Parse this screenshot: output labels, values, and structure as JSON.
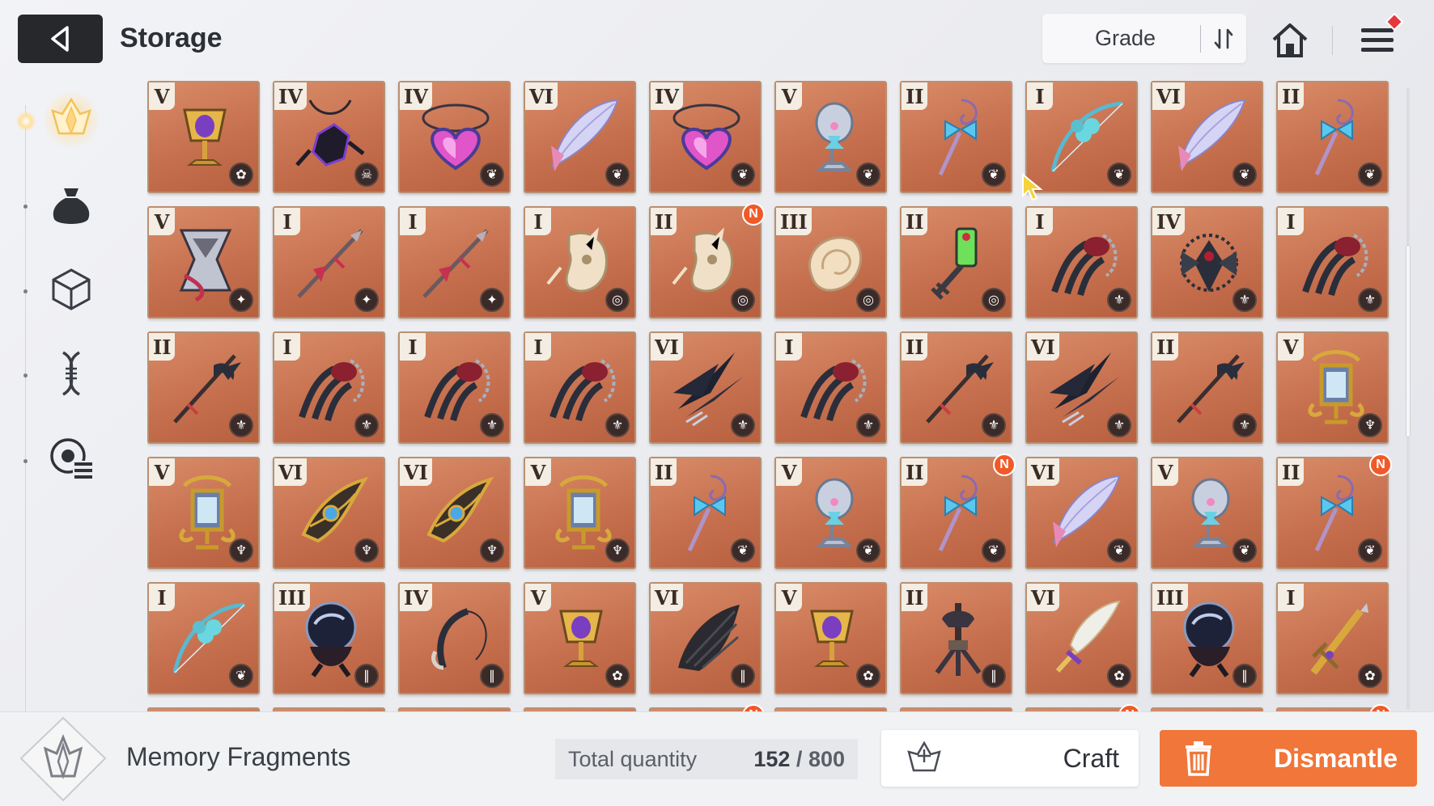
{
  "header": {
    "title": "Storage",
    "sort_label": "Grade"
  },
  "sidebar": {
    "items": [
      {
        "icon": "memory-fragment-icon",
        "active": true
      },
      {
        "icon": "bag-icon",
        "active": false
      },
      {
        "icon": "cube-icon",
        "active": false
      },
      {
        "icon": "dna-icon",
        "active": false
      },
      {
        "icon": "chip-list-icon",
        "active": false
      }
    ]
  },
  "inventory": {
    "items": [
      {
        "grade": "V",
        "art": "golden-chalice",
        "badge": "✿",
        "new": false
      },
      {
        "grade": "IV",
        "art": "dark-dragon-pendant",
        "badge": "☠",
        "new": false
      },
      {
        "grade": "IV",
        "art": "heart-necklace",
        "badge": "❦",
        "new": false
      },
      {
        "grade": "VI",
        "art": "feather-fan",
        "badge": "❦",
        "new": false
      },
      {
        "grade": "IV",
        "art": "heart-necklace",
        "badge": "❦",
        "new": false
      },
      {
        "grade": "V",
        "art": "crystal-goblet",
        "badge": "❦",
        "new": false
      },
      {
        "grade": "II",
        "art": "ribbon-key-staff",
        "badge": "❦",
        "new": false
      },
      {
        "grade": "I",
        "art": "clover-bow",
        "badge": "❦",
        "new": false
      },
      {
        "grade": "VI",
        "art": "feather-fan",
        "badge": "❦",
        "new": false
      },
      {
        "grade": "II",
        "art": "ribbon-key-staff",
        "badge": "❦",
        "new": false
      },
      {
        "grade": "V",
        "art": "silver-hourglass",
        "badge": "✦",
        "new": false
      },
      {
        "grade": "I",
        "art": "red-spear",
        "badge": "✦",
        "new": false
      },
      {
        "grade": "I",
        "art": "red-spear",
        "badge": "✦",
        "new": false
      },
      {
        "grade": "I",
        "art": "bone-mask",
        "badge": "◎",
        "new": false
      },
      {
        "grade": "II",
        "art": "bone-mask",
        "badge": "◎",
        "new": true
      },
      {
        "grade": "III",
        "art": "cream-shell",
        "badge": "◎",
        "new": false
      },
      {
        "grade": "II",
        "art": "potion-key",
        "badge": "◎",
        "new": false
      },
      {
        "grade": "I",
        "art": "chain-claw",
        "badge": "⚜",
        "new": false
      },
      {
        "grade": "IV",
        "art": "spiked-crest",
        "badge": "⚜",
        "new": false
      },
      {
        "grade": "I",
        "art": "chain-claw",
        "badge": "⚜",
        "new": false
      },
      {
        "grade": "II",
        "art": "dark-halberd",
        "badge": "⚜",
        "new": false
      },
      {
        "grade": "I",
        "art": "chain-claw",
        "badge": "⚜",
        "new": false
      },
      {
        "grade": "I",
        "art": "chain-claw",
        "badge": "⚜",
        "new": false
      },
      {
        "grade": "I",
        "art": "chain-claw",
        "badge": "⚜",
        "new": false
      },
      {
        "grade": "VI",
        "art": "shadow-blades",
        "badge": "⚜",
        "new": false
      },
      {
        "grade": "I",
        "art": "chain-claw",
        "badge": "⚜",
        "new": false
      },
      {
        "grade": "II",
        "art": "dark-halberd",
        "badge": "⚜",
        "new": false
      },
      {
        "grade": "VI",
        "art": "shadow-blades",
        "badge": "⚜",
        "new": false
      },
      {
        "grade": "II",
        "art": "dark-halberd",
        "badge": "⚜",
        "new": false
      },
      {
        "grade": "V",
        "art": "golden-lantern",
        "badge": "♆",
        "new": false
      },
      {
        "grade": "V",
        "art": "golden-lantern",
        "badge": "♆",
        "new": false
      },
      {
        "grade": "VI",
        "art": "golden-crest",
        "badge": "♆",
        "new": false
      },
      {
        "grade": "VI",
        "art": "golden-crest",
        "badge": "♆",
        "new": false
      },
      {
        "grade": "V",
        "art": "golden-lantern",
        "badge": "♆",
        "new": false
      },
      {
        "grade": "II",
        "art": "ribbon-key-staff",
        "badge": "❦",
        "new": false
      },
      {
        "grade": "V",
        "art": "crystal-goblet",
        "badge": "❦",
        "new": false
      },
      {
        "grade": "II",
        "art": "ribbon-key-staff",
        "badge": "❦",
        "new": true
      },
      {
        "grade": "VI",
        "art": "feather-fan",
        "badge": "❦",
        "new": false
      },
      {
        "grade": "V",
        "art": "crystal-goblet",
        "badge": "❦",
        "new": false
      },
      {
        "grade": "II",
        "art": "ribbon-key-staff",
        "badge": "❦",
        "new": true
      },
      {
        "grade": "I",
        "art": "clover-bow",
        "badge": "❦",
        "new": false
      },
      {
        "grade": "III",
        "art": "dark-orb-figure",
        "badge": "∥",
        "new": false
      },
      {
        "grade": "IV",
        "art": "hook-talisman",
        "badge": "∥",
        "new": false
      },
      {
        "grade": "V",
        "art": "golden-chalice",
        "badge": "✿",
        "new": false
      },
      {
        "grade": "VI",
        "art": "black-wing",
        "badge": "∥",
        "new": false
      },
      {
        "grade": "V",
        "art": "golden-chalice",
        "badge": "✿",
        "new": false
      },
      {
        "grade": "II",
        "art": "mech-claw",
        "badge": "∥",
        "new": false
      },
      {
        "grade": "VI",
        "art": "winged-sword",
        "badge": "✿",
        "new": false
      },
      {
        "grade": "III",
        "art": "dark-orb-figure",
        "badge": "∥",
        "new": false
      },
      {
        "grade": "I",
        "art": "ornate-dagger",
        "badge": "✿",
        "new": false
      },
      {
        "grade": "",
        "art": "",
        "badge": "",
        "new": false
      },
      {
        "grade": "",
        "art": "",
        "badge": "",
        "new": false
      },
      {
        "grade": "",
        "art": "",
        "badge": "",
        "new": false
      },
      {
        "grade": "",
        "art": "",
        "badge": "",
        "new": false
      },
      {
        "grade": "",
        "art": "",
        "badge": "",
        "new": true
      },
      {
        "grade": "",
        "art": "",
        "badge": "",
        "new": false
      },
      {
        "grade": "",
        "art": "",
        "badge": "",
        "new": false
      },
      {
        "grade": "",
        "art": "",
        "badge": "",
        "new": true
      },
      {
        "grade": "",
        "art": "",
        "badge": "",
        "new": false
      },
      {
        "grade": "",
        "art": "",
        "badge": "",
        "new": true
      }
    ],
    "new_marker": "N"
  },
  "footer": {
    "category_label": "Memory Fragments",
    "quantity_label": "Total quantity",
    "quantity_current": "152",
    "quantity_sep": " / ",
    "quantity_max": "800",
    "craft_label": "Craft",
    "dismantle_label": "Dismantle"
  },
  "colors": {
    "card_bg": "#c6704f",
    "accent_orange": "#f0763a",
    "new_badge": "#f05a28",
    "back_button": "#26282c"
  }
}
